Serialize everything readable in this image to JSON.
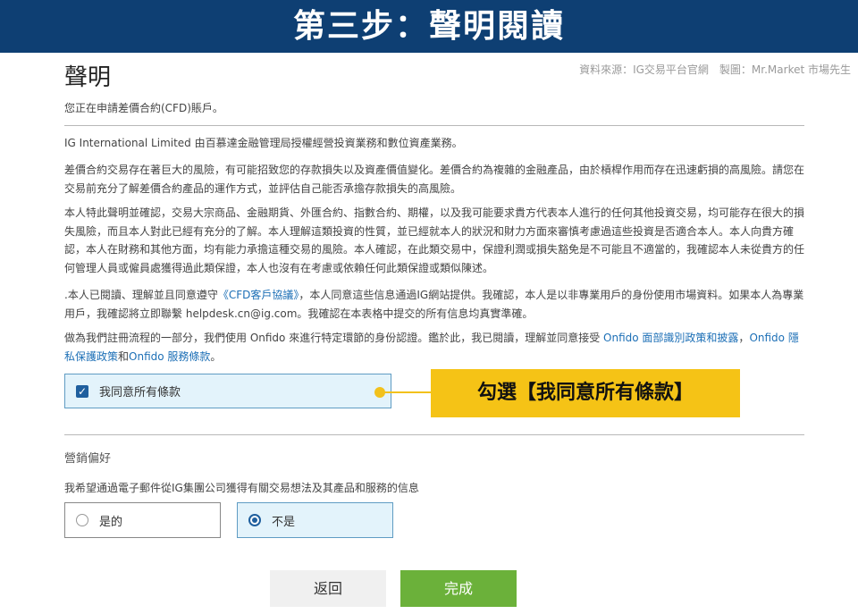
{
  "banner": {
    "title": "第三步：聲明閱讀"
  },
  "header": {
    "page_title": "聲明",
    "source_note": "資料來源：IG交易平台官網　製圖：Mr.Market 市場先生",
    "subtitle": "您正在申請差價合約(CFD)賬戶。"
  },
  "declaration": {
    "p1": "IG International Limited 由百慕達金融管理局授權經營投資業務和數位資產業務。",
    "p2": "差價合約交易存在著巨大的風險，有可能招致您的存款損失以及資產價值變化。差價合約為複雜的金融產品，由於槓桿作用而存在迅速虧損的高風險。請您在交易前充分了解差價合約產品的運作方式，並評估自己能否承擔存款損失的高風險。",
    "p3": "本人特此聲明並確認，交易大宗商品、金融期貨、外匯合約、指數合約、期權，以及我可能要求貴方代表本人進行的任何其他投資交易，均可能存在很大的損失風險，而且本人對此已經有充分的了解。本人理解這類投資的性質，並已經就本人的狀況和財力方面來審慎考慮過這些投資是否適合本人。本人向貴方確認，本人在財務和其他方面，均有能力承擔這種交易的風險。本人確認，在此類交易中，保證利潤或損失豁免是不可能且不適當的，我確認本人未從貴方的任何管理人員或僱員處獲得過此類保證，本人也沒有在考慮或依賴任何此類保證或類似陳述。",
    "p4_a": ".本人已閱讀、理解並且同意遵守",
    "p4_link": "《CFD客戶協議》",
    "p4_b": "，本人同意這些信息通過IG網站提供。我確認，本人是以非專業用戶的身份使用市場資料。如果本人為專業用戶，我確認將立即聯繫",
    "p4_email": "helpdesk.cn@ig.com",
    "p4_c": "。我確認在本表格中提交的所有信息均真實準確。",
    "p5_a": "做為我們註冊流程的一部分，我們使用 Onfido 來進行特定環節的身份認證。鑑於此，我已閱讀，理解並同意接受",
    "p5_link1": "Onfido 面部識別政策和披露",
    "p5_sep": "，",
    "p5_link2": "Onfido 隱私保護政策",
    "p5_and": "和",
    "p5_link3": "Onfido 服務條款",
    "p5_end": "。"
  },
  "agree": {
    "label": "我同意所有條款",
    "checked": true
  },
  "callout": {
    "text": "勾選【我同意所有條款】",
    "color": "#f5c316"
  },
  "marketing": {
    "section_title": "營銷偏好",
    "question": "我希望通過電子郵件從IG集團公司獲得有關交易想法及其產品和服務的信息",
    "options": [
      {
        "label": "是的",
        "selected": false
      },
      {
        "label": "不是",
        "selected": true
      }
    ]
  },
  "buttons": {
    "back": "返回",
    "done": "完成"
  },
  "colors": {
    "banner": "#0e3f73",
    "accent": "#1f5f9e",
    "done_button": "#6bb13a"
  }
}
